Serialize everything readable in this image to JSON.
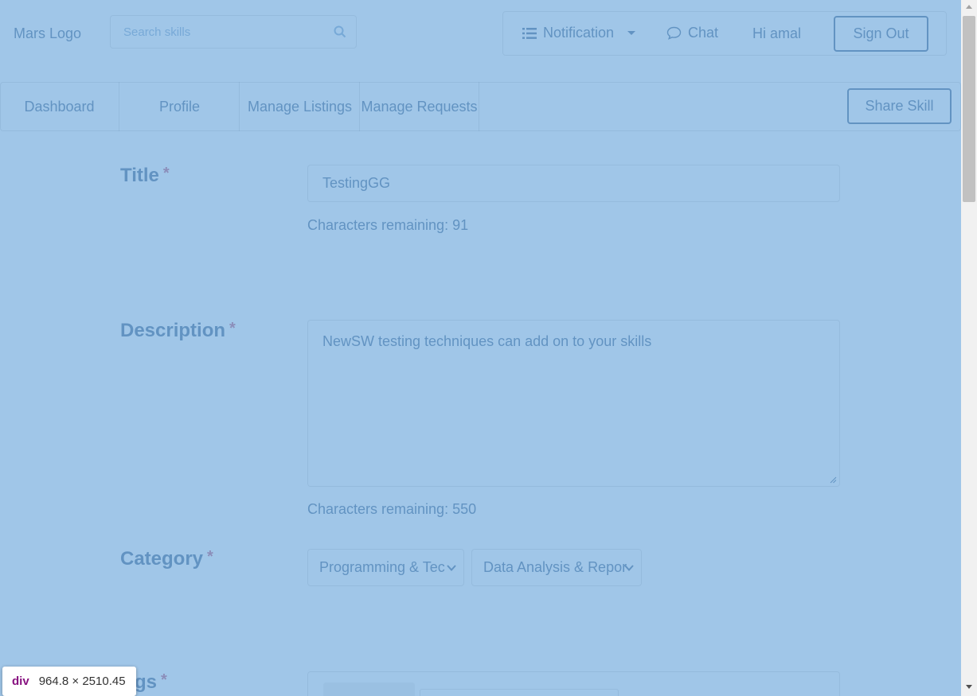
{
  "header": {
    "logo": "Mars Logo",
    "search_placeholder": "Search skills",
    "notification_label": "Notification",
    "chat_label": "Chat",
    "greeting": "Hi amal",
    "signout_label": "Sign Out"
  },
  "nav": {
    "tabs": [
      "Dashboard",
      "Profile",
      "Manage Listings",
      "Manage Requests"
    ],
    "share_label": "Share Skill"
  },
  "form": {
    "title": {
      "label": "Title",
      "required": "*",
      "value": "TestingGG",
      "remaining": "Characters remaining: 91"
    },
    "description": {
      "label": "Description",
      "required": "*",
      "value": "NewSW testing techniques can add on to your skills",
      "remaining": "Characters remaining: 550"
    },
    "category": {
      "label": "Category",
      "required": "*",
      "selected": "Programming & Tec",
      "subcategory_selected": "Data Analysis & Repor"
    },
    "tags": {
      "label": "gs",
      "required": "*"
    }
  },
  "devtools_tooltip": {
    "tag": "div",
    "dims": "964.8 × 2510.45"
  },
  "colors": {
    "overlay": "#6fa8dc",
    "text": "#4a6b8f",
    "required": "#c25b78"
  }
}
